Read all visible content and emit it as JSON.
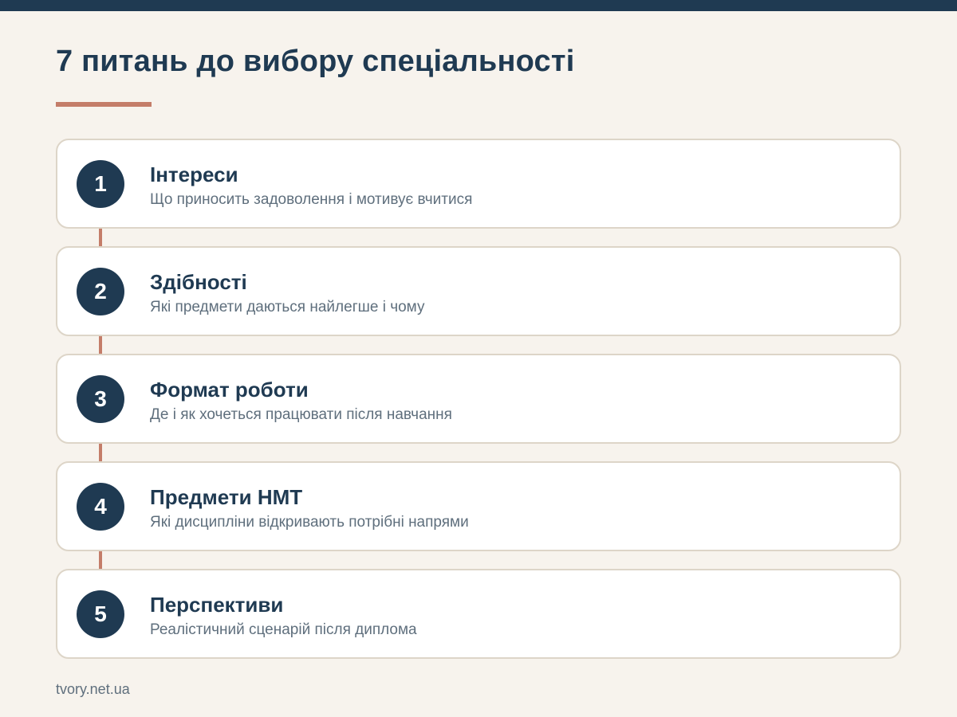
{
  "header": {
    "title": "7 питань до вибору спеціальності"
  },
  "steps": [
    {
      "number": "1",
      "title": "Інтереси",
      "description": "Що приносить задоволення і мотивує вчитися"
    },
    {
      "number": "2",
      "title": "Здібності",
      "description": "Які предмети даються найлегше і чому"
    },
    {
      "number": "3",
      "title": "Формат роботи",
      "description": "Де і як хочеться працювати після навчання"
    },
    {
      "number": "4",
      "title": "Предмети НМТ",
      "description": "Які дисципліни відкривають потрібні напрями"
    },
    {
      "number": "5",
      "title": "Перспективи",
      "description": "Реалістичний сценарій після диплома"
    }
  ],
  "footer": {
    "source": "tvory.net.ua"
  },
  "colors": {
    "background": "#f7f3ed",
    "primary": "#1f3a52",
    "accent": "#c47d69",
    "card_border": "#ddd5c8",
    "muted_text": "#5f6f7d"
  }
}
